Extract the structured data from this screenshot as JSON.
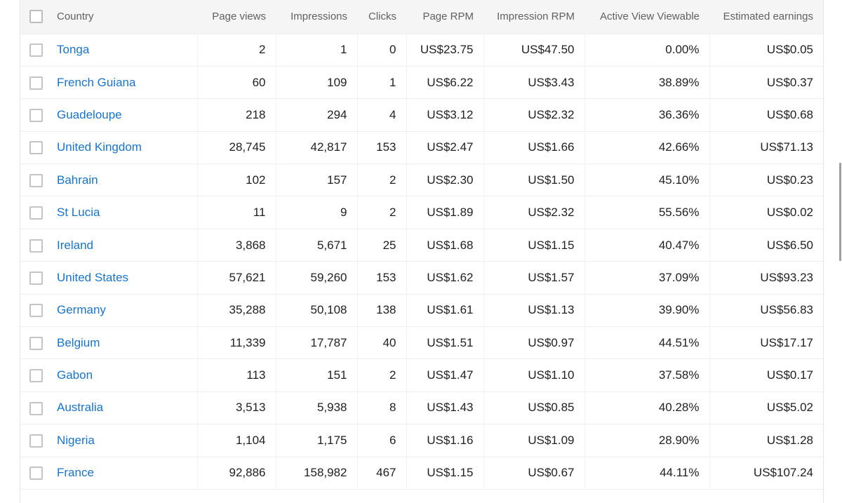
{
  "table": {
    "columns": [
      "Country",
      "Page views",
      "Impressions",
      "Clicks",
      "Page RPM",
      "Impression RPM",
      "Active View Viewable",
      "Estimated earnings"
    ],
    "rows": [
      {
        "country": "Tonga",
        "page_views": "2",
        "impressions": "1",
        "clicks": "0",
        "page_rpm": "US$23.75",
        "impression_rpm": "US$47.50",
        "active_view": "0.00%",
        "earnings": "US$0.05"
      },
      {
        "country": "French Guiana",
        "page_views": "60",
        "impressions": "109",
        "clicks": "1",
        "page_rpm": "US$6.22",
        "impression_rpm": "US$3.43",
        "active_view": "38.89%",
        "earnings": "US$0.37"
      },
      {
        "country": "Guadeloupe",
        "page_views": "218",
        "impressions": "294",
        "clicks": "4",
        "page_rpm": "US$3.12",
        "impression_rpm": "US$2.32",
        "active_view": "36.36%",
        "earnings": "US$0.68"
      },
      {
        "country": "United Kingdom",
        "page_views": "28,745",
        "impressions": "42,817",
        "clicks": "153",
        "page_rpm": "US$2.47",
        "impression_rpm": "US$1.66",
        "active_view": "42.66%",
        "earnings": "US$71.13"
      },
      {
        "country": "Bahrain",
        "page_views": "102",
        "impressions": "157",
        "clicks": "2",
        "page_rpm": "US$2.30",
        "impression_rpm": "US$1.50",
        "active_view": "45.10%",
        "earnings": "US$0.23"
      },
      {
        "country": "St Lucia",
        "page_views": "11",
        "impressions": "9",
        "clicks": "2",
        "page_rpm": "US$1.89",
        "impression_rpm": "US$2.32",
        "active_view": "55.56%",
        "earnings": "US$0.02"
      },
      {
        "country": "Ireland",
        "page_views": "3,868",
        "impressions": "5,671",
        "clicks": "25",
        "page_rpm": "US$1.68",
        "impression_rpm": "US$1.15",
        "active_view": "40.47%",
        "earnings": "US$6.50"
      },
      {
        "country": "United States",
        "page_views": "57,621",
        "impressions": "59,260",
        "clicks": "153",
        "page_rpm": "US$1.62",
        "impression_rpm": "US$1.57",
        "active_view": "37.09%",
        "earnings": "US$93.23"
      },
      {
        "country": "Germany",
        "page_views": "35,288",
        "impressions": "50,108",
        "clicks": "138",
        "page_rpm": "US$1.61",
        "impression_rpm": "US$1.13",
        "active_view": "39.90%",
        "earnings": "US$56.83"
      },
      {
        "country": "Belgium",
        "page_views": "11,339",
        "impressions": "17,787",
        "clicks": "40",
        "page_rpm": "US$1.51",
        "impression_rpm": "US$0.97",
        "active_view": "44.51%",
        "earnings": "US$17.17"
      },
      {
        "country": "Gabon",
        "page_views": "113",
        "impressions": "151",
        "clicks": "2",
        "page_rpm": "US$1.47",
        "impression_rpm": "US$1.10",
        "active_view": "37.58%",
        "earnings": "US$0.17"
      },
      {
        "country": "Australia",
        "page_views": "3,513",
        "impressions": "5,938",
        "clicks": "8",
        "page_rpm": "US$1.43",
        "impression_rpm": "US$0.85",
        "active_view": "40.28%",
        "earnings": "US$5.02"
      },
      {
        "country": "Nigeria",
        "page_views": "1,104",
        "impressions": "1,175",
        "clicks": "6",
        "page_rpm": "US$1.16",
        "impression_rpm": "US$1.09",
        "active_view": "28.90%",
        "earnings": "US$1.28"
      },
      {
        "country": "France",
        "page_views": "92,886",
        "impressions": "158,982",
        "clicks": "467",
        "page_rpm": "US$1.15",
        "impression_rpm": "US$0.67",
        "active_view": "44.11%",
        "earnings": "US$107.24"
      }
    ]
  },
  "colors": {
    "link": "#1a73c8",
    "header_bg": "#f5f5f5",
    "header_text": "#616161",
    "cell_text": "#212121",
    "checkbox_border": "#c4c4c4"
  }
}
